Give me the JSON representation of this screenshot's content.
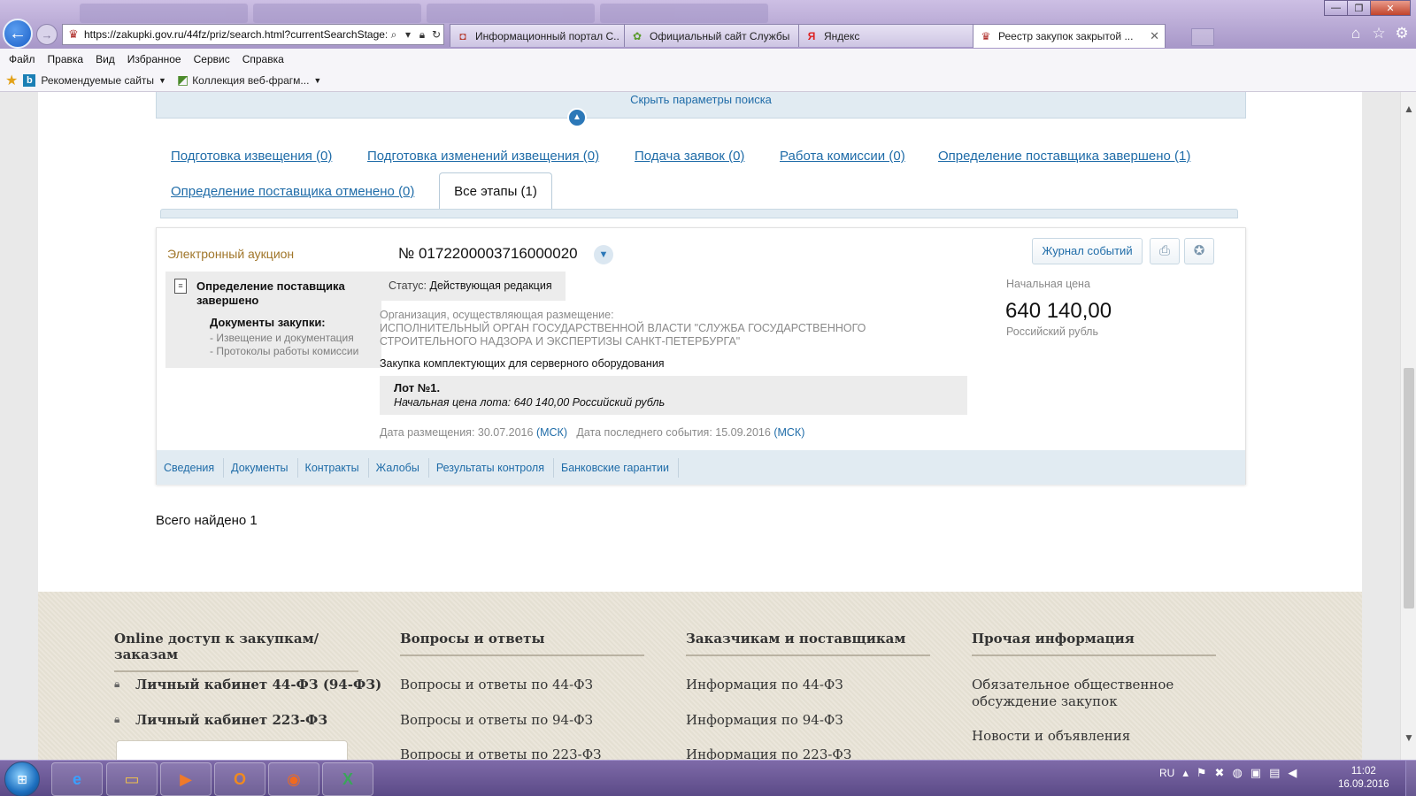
{
  "browser": {
    "url": "https://zakupki.gov.ru/44fz/priz/search.html?currentSearchStage:",
    "tabs": [
      {
        "label": "Информационный портал С...",
        "active": false
      },
      {
        "label": "Официальный сайт Службы ...",
        "active": false
      },
      {
        "label": "Яндекс",
        "active": false
      },
      {
        "label": "Реестр закупок закрытой ...",
        "active": true
      }
    ],
    "menu": [
      "Файл",
      "Правка",
      "Вид",
      "Избранное",
      "Сервис",
      "Справка"
    ],
    "favorites": {
      "recommended": "Рекомендуемые сайты",
      "slices": "Коллекция веб-фрагм..."
    }
  },
  "search": {
    "hide_params": "Скрыть параметры поиска"
  },
  "stages": {
    "row1": [
      "Подготовка извещения (0)",
      "Подготовка изменений извещения (0)",
      "Подача заявок (0)",
      "Работа комиссии (0)",
      "Определение поставщика завершено (1)"
    ],
    "row2": [
      "Определение поставщика отменено (0)"
    ],
    "active": "Все этапы (1)"
  },
  "record": {
    "procedure_type": "Электронный аукцион",
    "number": "№ 0172200003716000020",
    "events_button": "Журнал событий",
    "stage_status": "Определение поставщика завершено",
    "docs_heading": "Документы закупки:",
    "docs_links": [
      "- Извещение и документация",
      "- Протоколы работы комиссии"
    ],
    "status_label": "Статус:",
    "status_value": "Действующая редакция",
    "org_label": "Организация, осуществляющая размещение:",
    "org_name": "ИСПОЛНИТЕЛЬНЫЙ ОРГАН ГОСУДАРСТВЕННОЙ ВЛАСТИ \"СЛУЖБА ГОСУДАРСТВЕННОГО СТРОИТЕЛЬНОГО НАДЗОРА И ЭКСПЕРТИЗЫ САНКТ-ПЕТЕРБУРГА\"",
    "subject": "Закупка комплектующих для серверного оборудования",
    "lot_title": "Лот №1.",
    "lot_price": "Начальная цена лота: 640 140,00 Российский рубль",
    "date_published_label": "Дата размещения: 30.07.2016",
    "date_last_event_label": "Дата последнего события: 15.09.2016",
    "timezone": "(МСК)",
    "price_label": "Начальная цена",
    "price_value": "640 140,00",
    "price_currency": "Российский рубль",
    "card_tabs": [
      "Сведения",
      "Документы",
      "Контракты",
      "Жалобы",
      "Результаты контроля",
      "Банковские гарантии"
    ]
  },
  "results": {
    "total": "Всего найдено 1"
  },
  "footer": {
    "columns": [
      {
        "heading": "Online доступ к закупкам/заказам",
        "items": [
          "Личный кабинет 44-ФЗ (94-ФЗ)",
          "Личный кабинет 223-ФЗ"
        ]
      },
      {
        "heading": "Вопросы и ответы",
        "items": [
          "Вопросы и ответы по 44-ФЗ",
          "Вопросы и ответы по 94-ФЗ",
          "Вопросы и ответы по 223-ФЗ"
        ]
      },
      {
        "heading": "Заказчикам и поставщикам",
        "items": [
          "Информация по 44-ФЗ",
          "Информация по 94-ФЗ",
          "Информация по 223-ФЗ"
        ]
      },
      {
        "heading": "Прочая информация",
        "items": [
          "Обязательное общественное обсуждение закупок",
          "Новости и объявления"
        ]
      }
    ]
  },
  "taskbar": {
    "lang": "RU",
    "time": "11:02",
    "date": "16.09.2016"
  },
  "colors": {
    "link": "#1f6ca8",
    "procedure_type": "#a0762a",
    "panel": "#e1ebf2",
    "ie_frame": "#b3a5d3"
  }
}
